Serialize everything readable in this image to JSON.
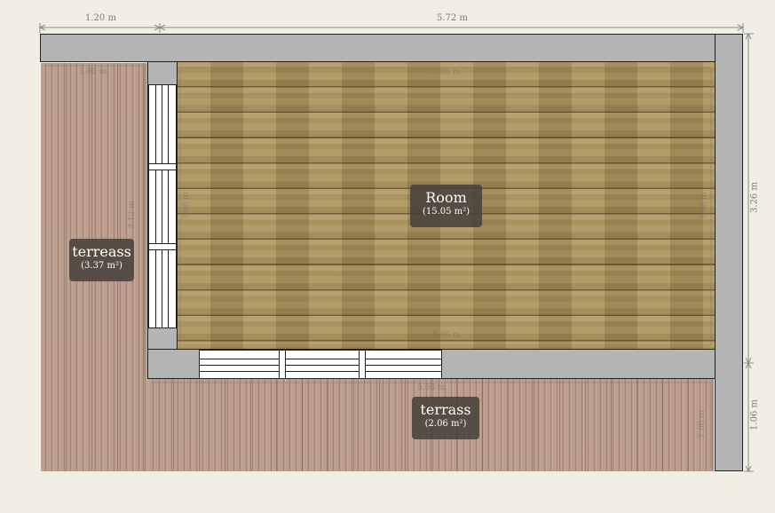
{
  "rooms": [
    {
      "id": "room",
      "name": "Room",
      "area": "(15.05 m²)"
    },
    {
      "id": "terreass",
      "name": "terreass",
      "area": "(3.37 m²)"
    },
    {
      "id": "terrass",
      "name": "terrass",
      "area": "(2.06 m²)"
    }
  ],
  "dimensions": {
    "top_left": "1.20 m",
    "top_main": "5.72 m",
    "right_upper": "3.26 m",
    "right_lower": "1.06 m"
  },
  "inner_dimensions": {
    "left_terrace_width": "1.05 m",
    "left_terrace_height": "3.12 m",
    "room_top": "5.96 m",
    "room_bottom": "5.96 m",
    "room_left": "3.08 m",
    "room_right": "3.08 m",
    "bottom_terrace_width": "5.58 m",
    "bottom_terrace_height": "1.06 m"
  },
  "colors": {
    "background": "#f1efe4",
    "wall": "#b4b4b4",
    "deck": "#c0a292",
    "wood_floor": "#a58d5c",
    "label_bg": "#48423c"
  }
}
